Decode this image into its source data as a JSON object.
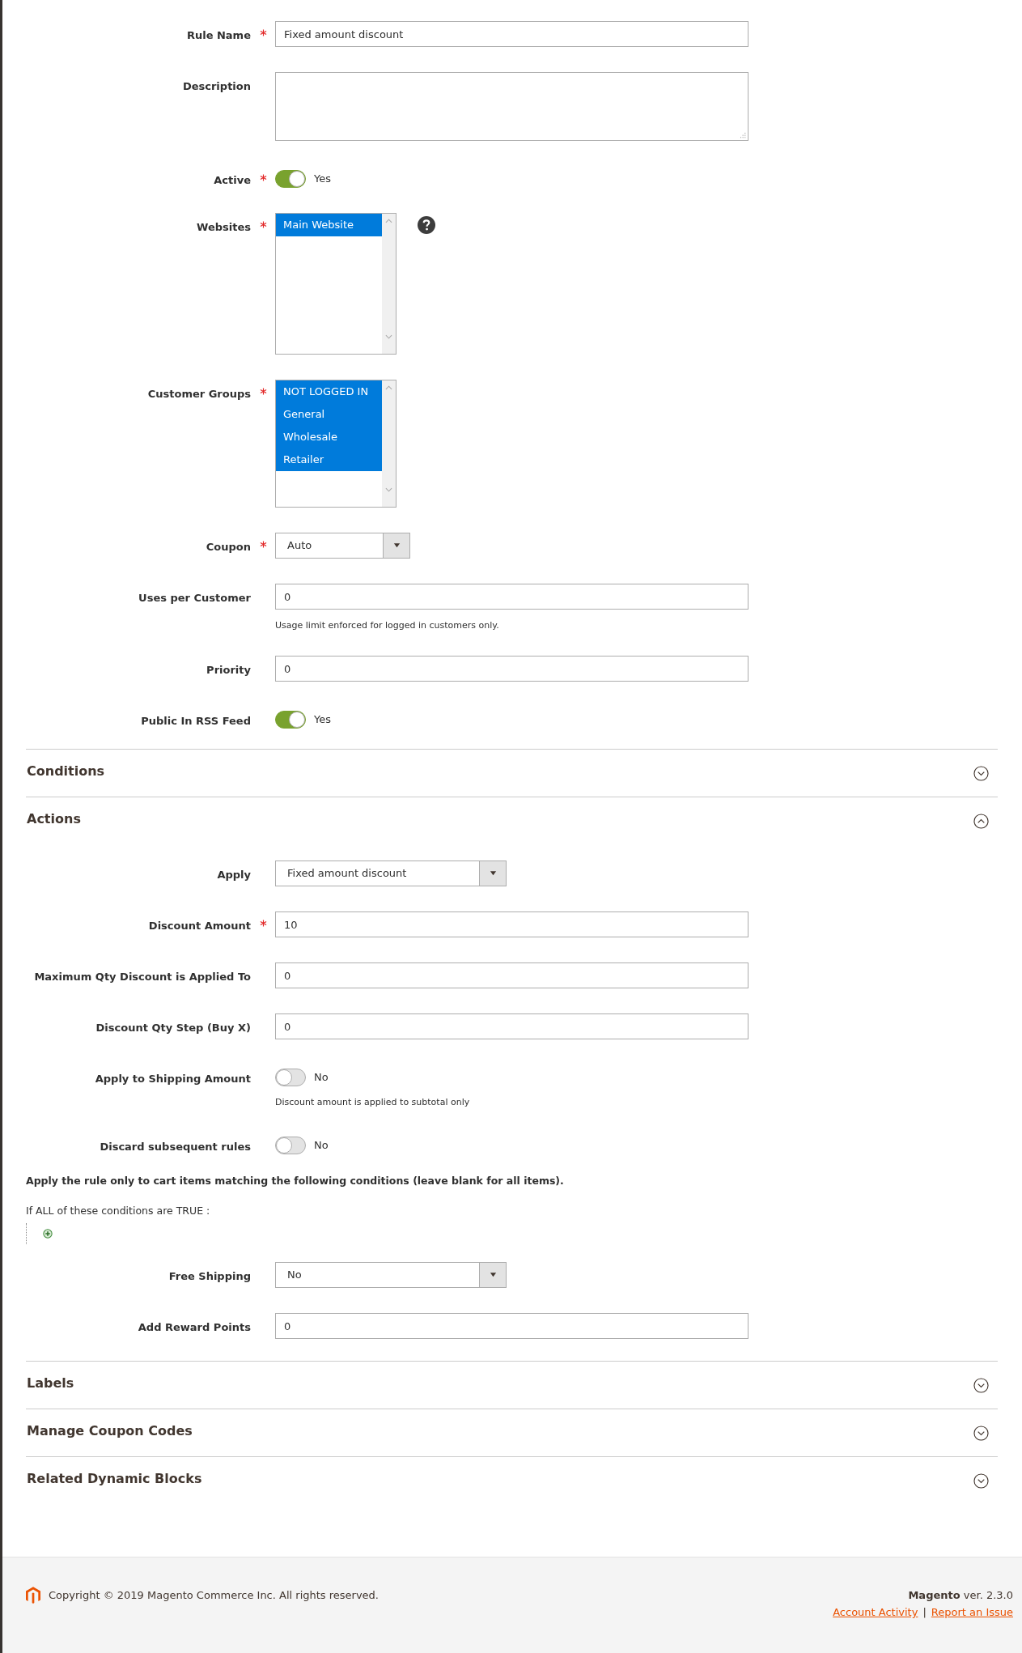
{
  "general_fields": [
    {
      "kind": "text",
      "label": "Rule Name",
      "required": true,
      "value": "Fixed amount discount"
    },
    {
      "kind": "textarea",
      "label": "Description",
      "required": false
    },
    {
      "kind": "toggle",
      "label": "Active",
      "required": true,
      "on": true,
      "state_text": "Yes"
    },
    {
      "kind": "multiselect",
      "label": "Websites",
      "required": true,
      "help": true,
      "options": [
        {
          "label": "Main Website",
          "selected": true
        }
      ]
    },
    {
      "kind": "multiselect",
      "label": "Customer Groups",
      "required": true,
      "options": [
        {
          "label": "NOT LOGGED IN",
          "selected": true
        },
        {
          "label": "General",
          "selected": true
        },
        {
          "label": "Wholesale",
          "selected": true
        },
        {
          "label": "Retailer",
          "selected": true
        }
      ]
    },
    {
      "kind": "select",
      "label": "Coupon",
      "required": true,
      "value": "Auto"
    },
    {
      "kind": "text",
      "label": "Uses per Customer",
      "required": false,
      "value": "0",
      "note": "Usage limit enforced for logged in customers only."
    },
    {
      "kind": "text",
      "label": "Priority",
      "required": false,
      "value": "0"
    },
    {
      "kind": "toggle",
      "label": "Public In RSS Feed",
      "required": false,
      "on": true,
      "state_text": "Yes"
    }
  ],
  "sections": [
    {
      "title": "Conditions",
      "expanded": false
    },
    {
      "title": "Actions",
      "expanded": true,
      "fields": [
        {
          "kind": "select",
          "label": "Apply",
          "required": false,
          "value": "Fixed amount discount"
        },
        {
          "kind": "text",
          "label": "Discount Amount",
          "required": true,
          "value": "10"
        },
        {
          "kind": "text",
          "label": "Maximum Qty Discount is Applied To",
          "required": false,
          "value": "0"
        },
        {
          "kind": "text",
          "label": "Discount Qty Step (Buy X)",
          "required": false,
          "value": "0"
        },
        {
          "kind": "toggle",
          "label": "Apply to Shipping Amount",
          "required": false,
          "on": false,
          "state_text": "No",
          "note": "Discount amount is applied to subtotal only"
        },
        {
          "kind": "toggle",
          "label": "Discard subsequent rules",
          "required": false,
          "on": false,
          "state_text": "No"
        }
      ],
      "rule_note": "Apply the rule only to cart items matching the following conditions (leave blank for all items).",
      "condition_line": "If ALL  of these conditions are TRUE :",
      "extra_fields": [
        {
          "kind": "select",
          "label": "Free Shipping",
          "required": false,
          "value": "No"
        },
        {
          "kind": "text",
          "label": "Add Reward Points",
          "required": false,
          "value": "0"
        }
      ]
    },
    {
      "title": "Labels",
      "expanded": false
    },
    {
      "title": "Manage Coupon Codes",
      "expanded": false
    },
    {
      "title": "Related Dynamic Blocks",
      "expanded": false
    }
  ],
  "footer": {
    "copyright": "Copyright © 2019 Magento Commerce Inc. All rights reserved.",
    "version": "**Magento** ver. 2.3.0",
    "links": [
      "Account Activity",
      "Report an Issue"
    ],
    "separator": "|"
  }
}
